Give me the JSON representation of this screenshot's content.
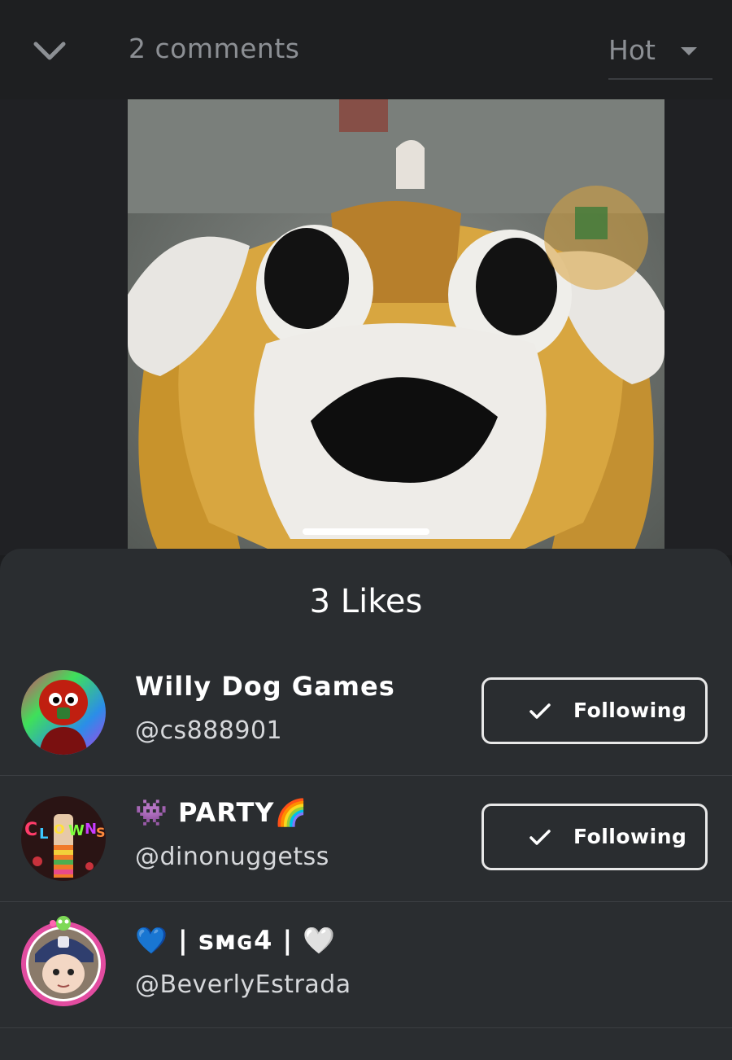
{
  "header": {
    "collapse_icon": "chevron-down-icon",
    "comments_count": "2 comments",
    "sort_selected": "Hot",
    "sort_icon": "caret-down-icon"
  },
  "likes_sheet": {
    "title": "3 Likes",
    "users": [
      {
        "name_emoji_prefix": "",
        "name": "Willy Dog Games",
        "name_emoji_suffix": "",
        "handle": "@cs888901",
        "button": "Following"
      },
      {
        "name_emoji_prefix": "👾",
        "name": "PARTY",
        "name_emoji_suffix": "🌈",
        "handle": "@dinonuggetss",
        "button": "Following"
      },
      {
        "name_emoji_prefix": "💙",
        "name": " | sᴍɢ4 | ",
        "name_emoji_suffix": "🤍",
        "handle": "@BeverlyEstrada",
        "button": ""
      }
    ]
  },
  "colors": {
    "background": "#1c1d1f",
    "sheet": "#2a2d30",
    "muted_text": "#8c8f94",
    "button_border": "#e8e8e8"
  }
}
